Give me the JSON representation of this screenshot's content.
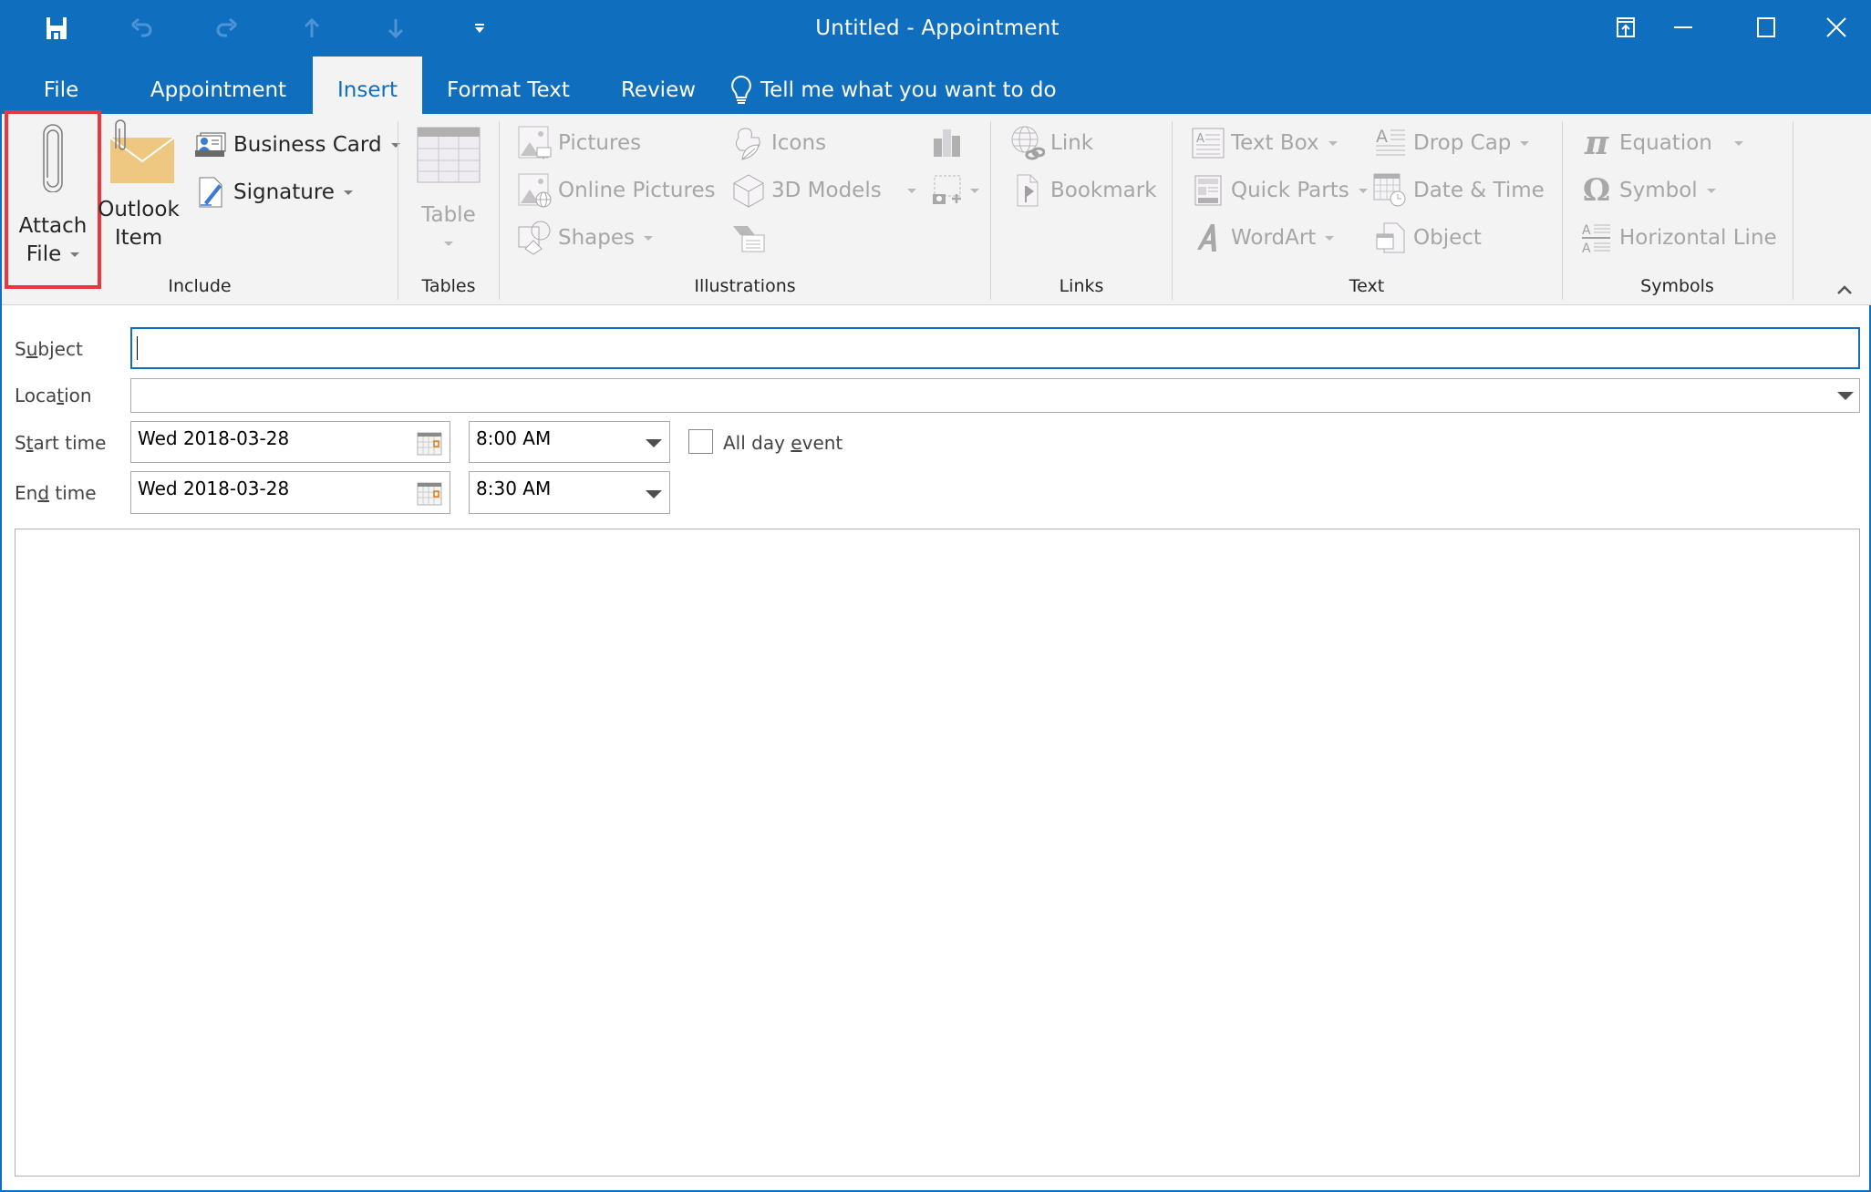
{
  "window": {
    "title": "Untitled  -  Appointment",
    "quick_access": [
      "save-icon",
      "undo-icon",
      "redo-icon",
      "previous-item-icon",
      "next-item-icon",
      "customize-qat-icon"
    ],
    "controls": [
      "ribbon-display-options-icon",
      "minimize-icon",
      "maximize-icon",
      "close-icon"
    ]
  },
  "tabs": [
    {
      "label": "File",
      "active": false
    },
    {
      "label": "Appointment",
      "active": false
    },
    {
      "label": "Insert",
      "active": true
    },
    {
      "label": "Format Text",
      "active": false
    },
    {
      "label": "Review",
      "active": false
    }
  ],
  "tell_me": {
    "label": "Tell me what you want to do"
  },
  "ribbon": {
    "groups": {
      "include": {
        "label": "Include",
        "attach_file": {
          "line1": "Attach",
          "line2": "File",
          "highlighted": true
        },
        "outlook_item": {
          "line1": "Outlook",
          "line2": "Item"
        },
        "business_card": "Business Card",
        "signature": "Signature"
      },
      "tables": {
        "label": "Tables",
        "table": "Table"
      },
      "illustrations": {
        "label": "Illustrations",
        "pictures": "Pictures",
        "online_pictures": "Online Pictures",
        "shapes": "Shapes",
        "icons": "Icons",
        "models_3d": "3D Models"
      },
      "links": {
        "label": "Links",
        "link": "Link",
        "bookmark": "Bookmark"
      },
      "text": {
        "label": "Text",
        "text_box": "Text Box",
        "quick_parts": "Quick Parts",
        "wordart": "WordArt",
        "drop_cap": "Drop Cap",
        "date_time": "Date & Time",
        "object": "Object"
      },
      "symbols": {
        "label": "Symbols",
        "equation": "Equation",
        "symbol": "Symbol",
        "horizontal_line": "Horizontal Line"
      }
    }
  },
  "form": {
    "subject": {
      "label_pre": "S",
      "label_u": "u",
      "label_post": "bject",
      "value": ""
    },
    "location": {
      "label_pre": "Loca",
      "label_u": "t",
      "label_post": "ion",
      "value": ""
    },
    "start": {
      "label_pre": "S",
      "label_u": "t",
      "label_post": "art time",
      "date": "Wed 2018-03-28",
      "time": "8:00 AM"
    },
    "end": {
      "label_pre": "En",
      "label_u": "d",
      "label_post": " time",
      "date": "Wed 2018-03-28",
      "time": "8:30 AM"
    },
    "all_day": {
      "label_pre": "All day ",
      "label_u": "e",
      "label_post": "vent",
      "checked": false
    }
  },
  "colors": {
    "brand_blue": "#106ebe",
    "ribbon_bg": "#f3f3f3",
    "highlight_red": "#e8373f",
    "outlook_item_envelope": "#eec880"
  }
}
